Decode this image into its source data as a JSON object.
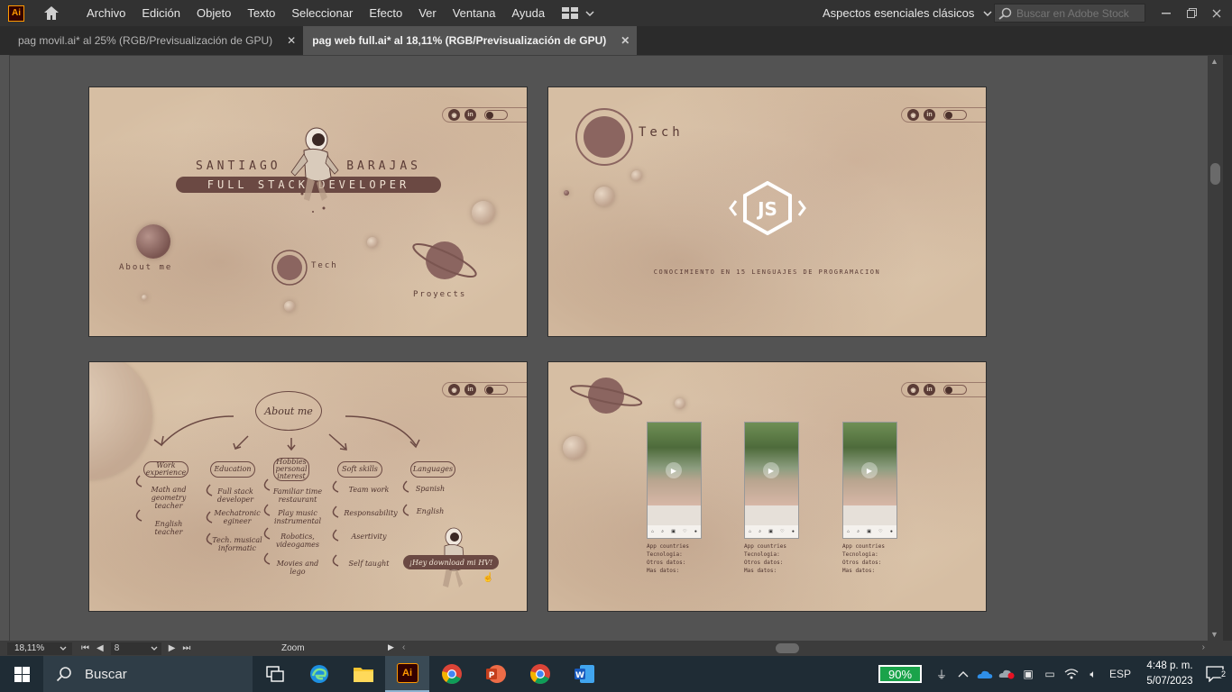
{
  "app": {
    "logo_text": "Ai"
  },
  "menu": [
    "Archivo",
    "Edición",
    "Objeto",
    "Texto",
    "Seleccionar",
    "Efecto",
    "Ver",
    "Ventana",
    "Ayuda"
  ],
  "workspace": {
    "label": "Aspectos esenciales clásicos"
  },
  "stock_search": {
    "placeholder": "Buscar en Adobe Stock"
  },
  "tabs": [
    {
      "label": "pag movil.ai* al 25% (RGB/Previsualización de GPU)",
      "active": false
    },
    {
      "label": "pag web full.ai* al 18,11% (RGB/Previsualización de GPU)",
      "active": true
    }
  ],
  "tab_close_glyph": "✕",
  "artboard1": {
    "first_name": "SANTIAGO",
    "last_name": "BARAJAS",
    "role": "FULL STACK DEVELOPER",
    "about": "About me",
    "tech": "Tech",
    "projects": "Proyects"
  },
  "artboard2": {
    "title": "Tech",
    "subtitle": "CONOCIMIENTO EN 15 LENGUAJES DE PROGRAMACION"
  },
  "artboard3": {
    "center": "About me",
    "nodes": [
      "Work experience",
      "Education",
      "Hobbies personal interest",
      "Soft skills",
      "Languages"
    ],
    "work": [
      "Math and geometry teacher",
      "English teacher"
    ],
    "education": [
      "Full stack developer",
      "Mechatronic egineer",
      "Tech. musical informatic"
    ],
    "hobbies": [
      "Familiar time restaurant",
      "Play music instrumental",
      "Robotics, videogames",
      "Movies and lego"
    ],
    "soft": [
      "Team work",
      "Responsability",
      "Asertivity",
      "Self taught"
    ],
    "languages": [
      "Spanish",
      "English"
    ],
    "cv_button": "¡Hey download mi HV!"
  },
  "artboard4": {
    "projects": [
      {
        "lines": [
          "App countries",
          "Tecnologia:",
          "Otros datos:",
          "Mas datos:"
        ]
      },
      {
        "lines": [
          "App countries",
          "Tecnologia:",
          "Otros datos:",
          "Mas datos:"
        ]
      },
      {
        "lines": [
          "App countries",
          "Tecnologia:",
          "Otros datos:",
          "Mas datos:"
        ]
      }
    ]
  },
  "statusbar": {
    "zoom": "18,11%",
    "artboard": "8",
    "label": "Zoom"
  },
  "taskbar": {
    "search": "Buscar",
    "battery": "90%",
    "lang": "ESP",
    "time": "4:48 p. m.",
    "date": "5/07/2023",
    "notifications": "2"
  }
}
